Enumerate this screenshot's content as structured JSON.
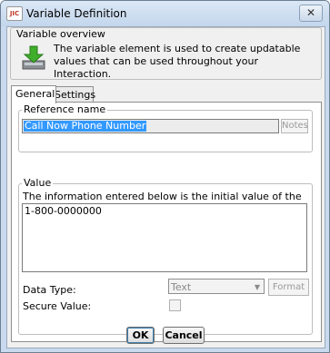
{
  "window": {
    "title": "Variable Definition",
    "close_glyph": "✕",
    "app_icon": "app-icon"
  },
  "overview": {
    "legend": "Variable overview",
    "icon": "download-arrow-icon",
    "text": "The variable element is used to create updatable values that can be used throughout your Interaction."
  },
  "tabs": [
    {
      "label": "General",
      "active": true
    },
    {
      "label": "Settings",
      "active": false
    }
  ],
  "reference": {
    "legend": "Reference name",
    "value": "Call Now Phone Number",
    "notes_label": "Notes"
  },
  "value": {
    "legend": "Value",
    "description": "The information entered below is the initial value of the variable:",
    "initial_value": "1-800-0000000",
    "data_type_label": "Data Type:",
    "data_type_value": "Text",
    "format_label": "Format",
    "secure_label": "Secure Value:",
    "secure_checked": false
  },
  "buttons": {
    "ok": "OK",
    "cancel": "Cancel"
  },
  "colors": {
    "selection": "#3399ff",
    "titlebar": "#c9daee",
    "arrow_green": "#3fae2a"
  }
}
